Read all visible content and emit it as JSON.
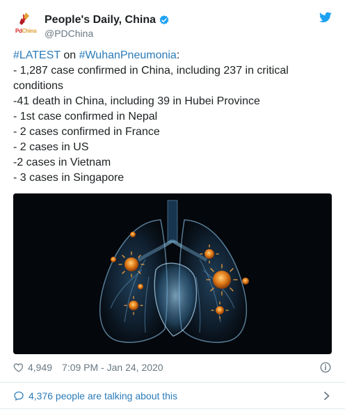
{
  "account": {
    "display_name": "People's Daily, China",
    "handle": "@PDChina",
    "avatar_text_red": "Pd",
    "avatar_text_gold": "China"
  },
  "tweet": {
    "hashtag_1": "#LATEST",
    "connector": " on ",
    "hashtag_2": "#WuhanPneumonia",
    "colon": ":",
    "lines": [
      "- 1,287 case confirmed in China, including 237 in critical",
      "conditions",
      "-41 death in China, including 39 in Hubei Province",
      "- 1st case confirmed in Nepal",
      "- 2 cases confirmed in France",
      "- 2 cases in US",
      "-2 cases in Vietnam",
      "- 3 cases in Singapore"
    ]
  },
  "meta": {
    "likes": "4,949",
    "timestamp": "7:09 PM - Jan 24, 2020"
  },
  "conversation": {
    "label": "4,376 people are talking about this"
  },
  "colors": {
    "link": "#2b7bb9",
    "muted": "#697882",
    "verified": "#1da1f2",
    "brand_red": "#d9252a"
  },
  "icons": [
    "verified-badge-icon",
    "twitter-bird-icon",
    "heart-icon",
    "info-icon",
    "speech-bubble-icon",
    "chevron-right-icon"
  ]
}
